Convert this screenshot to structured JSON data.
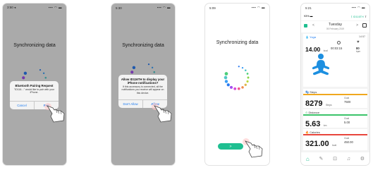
{
  "colors": {
    "accent_green": "#1fbf91",
    "dialog_blue": "#1d7cf2",
    "dots": [
      "#2a7af0",
      "#3b9ef5",
      "#52c7c7",
      "#4ccf7a",
      "#86d64a",
      "#b9d93d",
      "#e0b64a",
      "#f08a4e",
      "#f05a8c",
      "#d94ad9",
      "#a34ff0"
    ]
  },
  "screen1": {
    "status_time": "3:50 ◂",
    "status_right": "▪▪▪ ◠ ▬",
    "title": "Synchronizing data",
    "dialog_title": "Bluetooth Pairing Request",
    "dialog_body": "\"ID116…\" would like to pair with your iPhone.",
    "cancel": "Cancel",
    "pair": "Pair"
  },
  "screen2": {
    "status_time": "5:30",
    "status_right": "▪▪▪ ◠ ▬",
    "title": "Synchronizing data",
    "dialog_title": "Allow ID116TH to display your iPhone notifications?",
    "dialog_body": "If this accessory is connected, all the notifications you receive will appear on this device.",
    "dont_allow": "Don't Allow",
    "allow": "Allow"
  },
  "screen3": {
    "status_time": "5:09",
    "status_right": "▪▪▪ ◠ ▬",
    "title": "Synchronizing data",
    "next_label": ">"
  },
  "screen4": {
    "status_time": "5:21",
    "status_right": "▪▪▪ ◠ ▬",
    "battery": "93%",
    "device": "ID116TH",
    "day": "Tuesday",
    "date": "05 February 2019",
    "yoga_label": "Yoga",
    "yoga_time": "14:57",
    "kcal_value": "14.00",
    "kcal_unit": "kcal",
    "duration": "00:03:15",
    "bpm_value": "80",
    "bpm_unit": "bpm",
    "steps_label": "Steps",
    "steps_value": "8279",
    "steps_unit": "Steps",
    "steps_goal_label": "Goal",
    "steps_goal": "7500",
    "distance_label": "Distance",
    "distance_value": "5.63",
    "distance_unit": "km",
    "distance_goal_label": "Goal",
    "distance_goal": "5.00",
    "calories_label": "Calories",
    "calories_value": "321.00",
    "calories_unit": "kcal",
    "calories_goal_label": "Goal",
    "calories_goal": "450.00"
  }
}
